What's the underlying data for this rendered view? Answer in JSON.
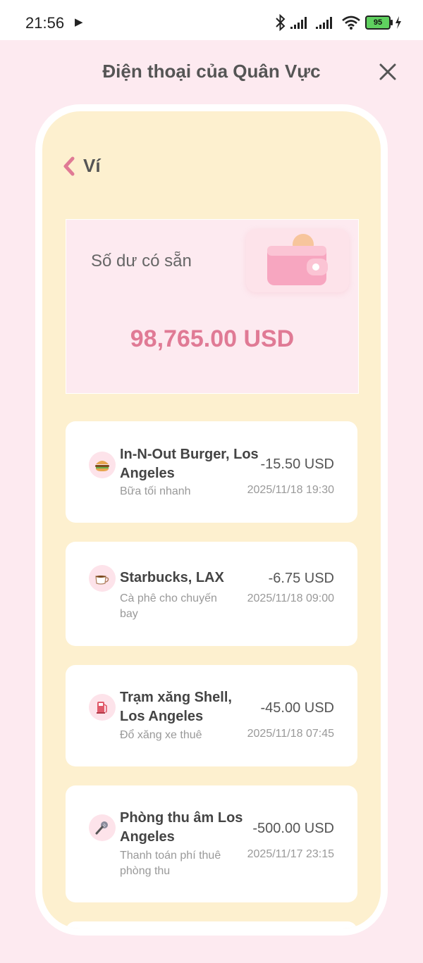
{
  "status_bar": {
    "time": "21:56",
    "battery": "95"
  },
  "header": {
    "title": "Điện thoại của Quân Vực"
  },
  "screen": {
    "back_title": "Ví",
    "balance": {
      "label": "Số dư có sẵn",
      "amount": "98,765.00 USD"
    },
    "transactions": [
      {
        "icon": "burger-icon",
        "merchant": "In-N-Out Burger, Los Angeles",
        "note": "Bữa tối nhanh",
        "amount": "-15.50 USD",
        "datetime": "2025/11/18 19:30"
      },
      {
        "icon": "coffee-icon",
        "merchant": "Starbucks, LAX",
        "note": "Cà phê cho chuyến bay",
        "amount": "-6.75 USD",
        "datetime": "2025/11/18 09:00"
      },
      {
        "icon": "fuel-pump-icon",
        "merchant": "Trạm xăng Shell, Los Angeles",
        "note": "Đổ xăng xe thuê",
        "amount": "-45.00 USD",
        "datetime": "2025/11/18 07:45"
      },
      {
        "icon": "microphone-icon",
        "merchant": "Phòng thu âm Los Angeles",
        "note": "Thanh toán phí thuê phòng thu",
        "amount": "-500.00 USD",
        "datetime": "2025/11/17 23:15"
      }
    ]
  },
  "colors": {
    "page_bg": "#fdeaf0",
    "screen_bg": "#fdf0cf",
    "accent_pink": "#e07a95",
    "battery_green": "#5fd15f"
  }
}
